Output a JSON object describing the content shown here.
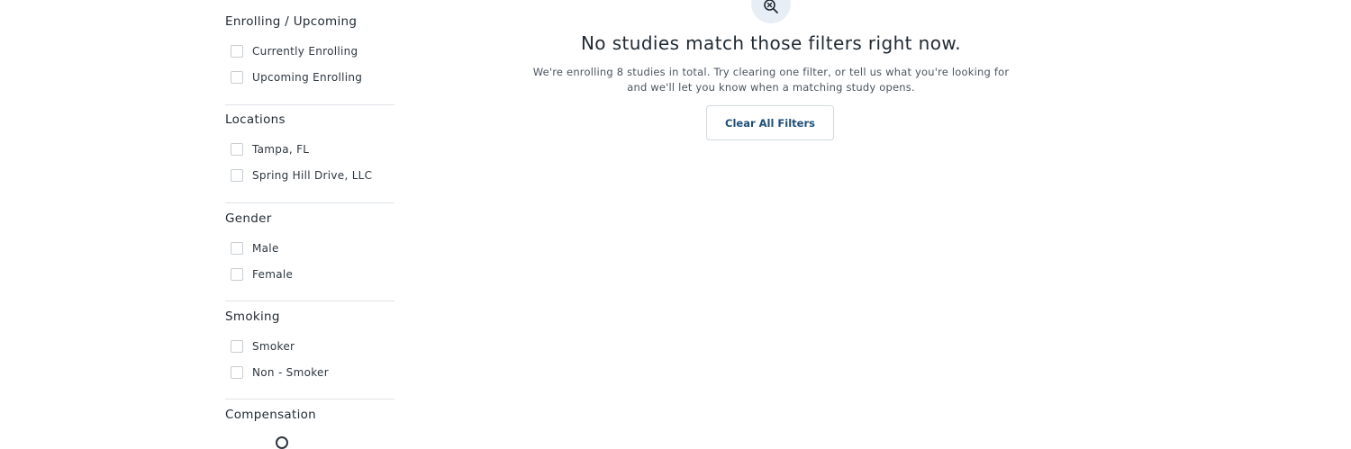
{
  "filters": {
    "enrolling": {
      "title": "Enrolling / Upcoming",
      "options": [
        "Currently Enrolling",
        "Upcoming Enrolling"
      ]
    },
    "locations": {
      "title": "Locations",
      "options": [
        "Tampa, FL",
        "Spring Hill Drive, LLC"
      ]
    },
    "gender": {
      "title": "Gender",
      "options": [
        "Male",
        "Female"
      ]
    },
    "smoking": {
      "title": "Smoking",
      "options": [
        "Smoker",
        "Non - Smoker"
      ]
    },
    "compensation": {
      "title": "Compensation"
    }
  },
  "empty_state": {
    "icon": "search-x-icon",
    "title": "No studies match those filters right now.",
    "description": "We're enrolling 8 studies in total. Try clearing one filter, or tell us what you're looking for and we'll let you know when a matching study opens.",
    "clear_button": "Clear All Filters"
  },
  "colors": {
    "accent": "#1e4f7a",
    "icon_badge": "#e8eef5",
    "divider": "#dfe3e7"
  }
}
